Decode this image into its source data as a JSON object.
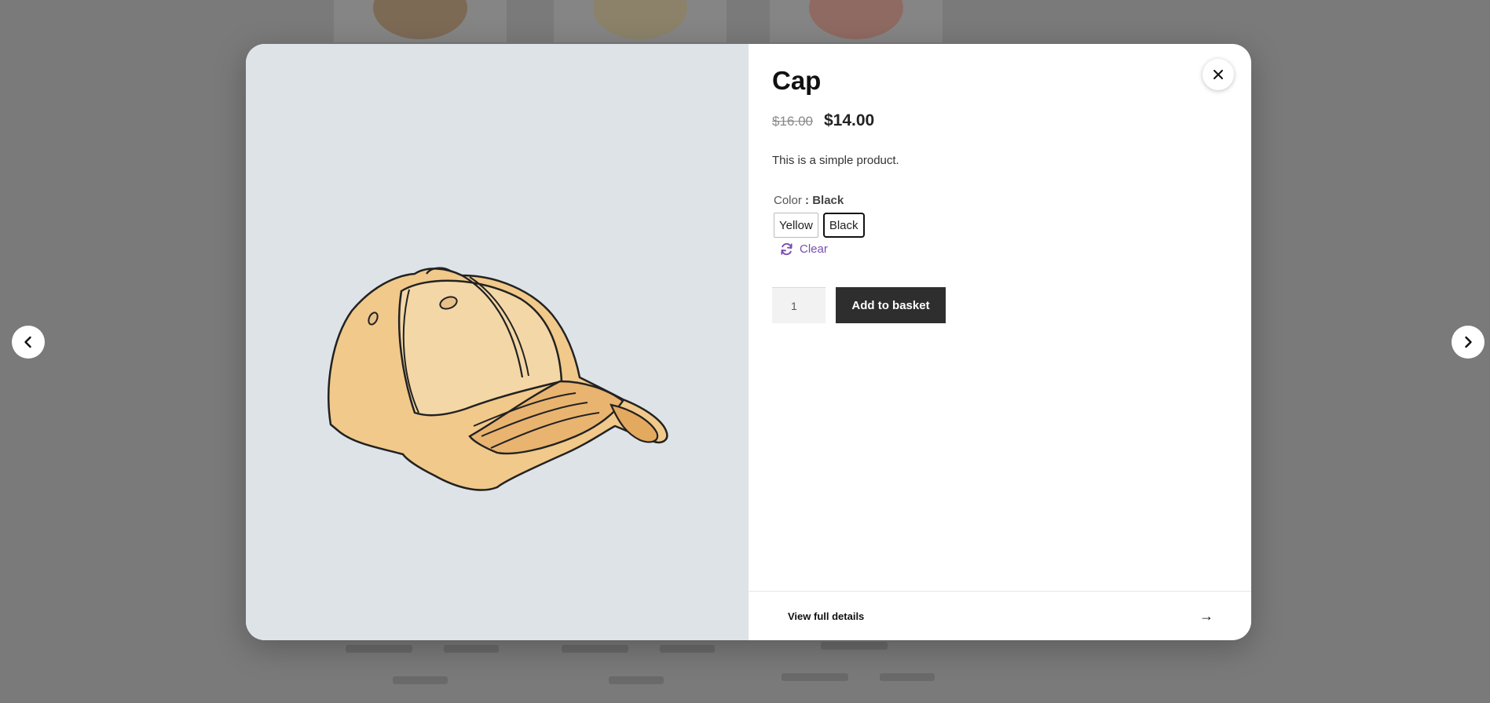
{
  "product": {
    "title": "Cap",
    "regular_price": "$16.00",
    "sale_price": "$14.00",
    "description": "This is a simple product.",
    "attribute": {
      "label": "Color",
      "separator": " : ",
      "selected": "Black",
      "options": [
        "Yellow",
        "Black"
      ]
    },
    "clear_label": "Clear",
    "quantity": "1",
    "add_to_basket_label": "Add to basket"
  },
  "footer": {
    "view_details_label": "View full details",
    "arrow": "→"
  },
  "icons": {
    "close": "close-icon",
    "prev": "chevron-left-icon",
    "next": "chevron-right-icon",
    "clear": "refresh-icon"
  },
  "colors": {
    "accent": "#7b4bb2",
    "button_dark": "#2e2e2e",
    "media_bg": "#dee3e8",
    "overlay": "#7a7a7a"
  }
}
